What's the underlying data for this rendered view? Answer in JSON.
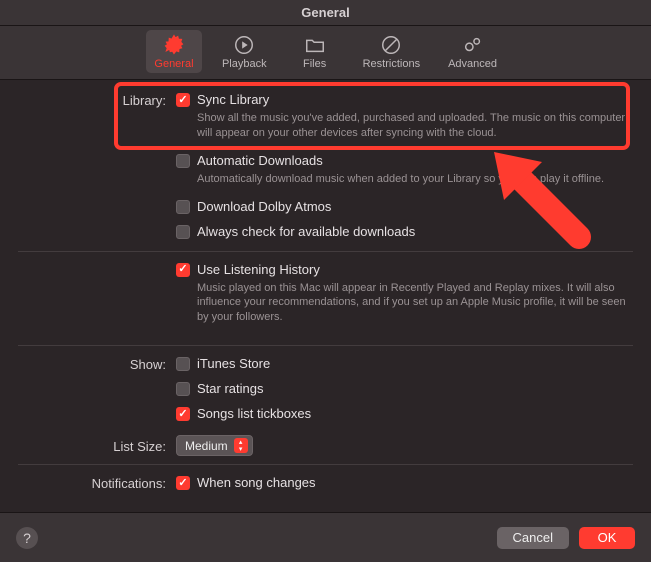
{
  "window": {
    "title": "General"
  },
  "tabs": {
    "general": "General",
    "playback": "Playback",
    "files": "Files",
    "restrictions": "Restrictions",
    "advanced": "Advanced"
  },
  "sections": {
    "library": {
      "label": "Library:",
      "sync": {
        "label": "Sync Library",
        "desc": "Show all the music you've added, purchased and uploaded. The music on this computer will appear on your other devices after syncing with the cloud."
      },
      "auto": {
        "label": "Automatic Downloads",
        "desc": "Automatically download music when added to your Library so you can play it offline."
      },
      "atmos": {
        "label": "Download Dolby Atmos"
      },
      "check_downloads": {
        "label": "Always check for available downloads"
      },
      "history": {
        "label": "Use Listening History",
        "desc": "Music played on this Mac will appear in Recently Played and Replay mixes. It will also influence your recommendations, and if you set up an Apple Music profile, it will be seen by your followers."
      }
    },
    "show": {
      "label": "Show:",
      "itunes": "iTunes Store",
      "star": "Star ratings",
      "tickboxes": "Songs list tickboxes"
    },
    "listsize": {
      "label": "List Size:",
      "value": "Medium"
    },
    "notifications": {
      "label": "Notifications:",
      "song_changes": "When song changes"
    }
  },
  "footer": {
    "help": "?",
    "cancel": "Cancel",
    "ok": "OK"
  }
}
